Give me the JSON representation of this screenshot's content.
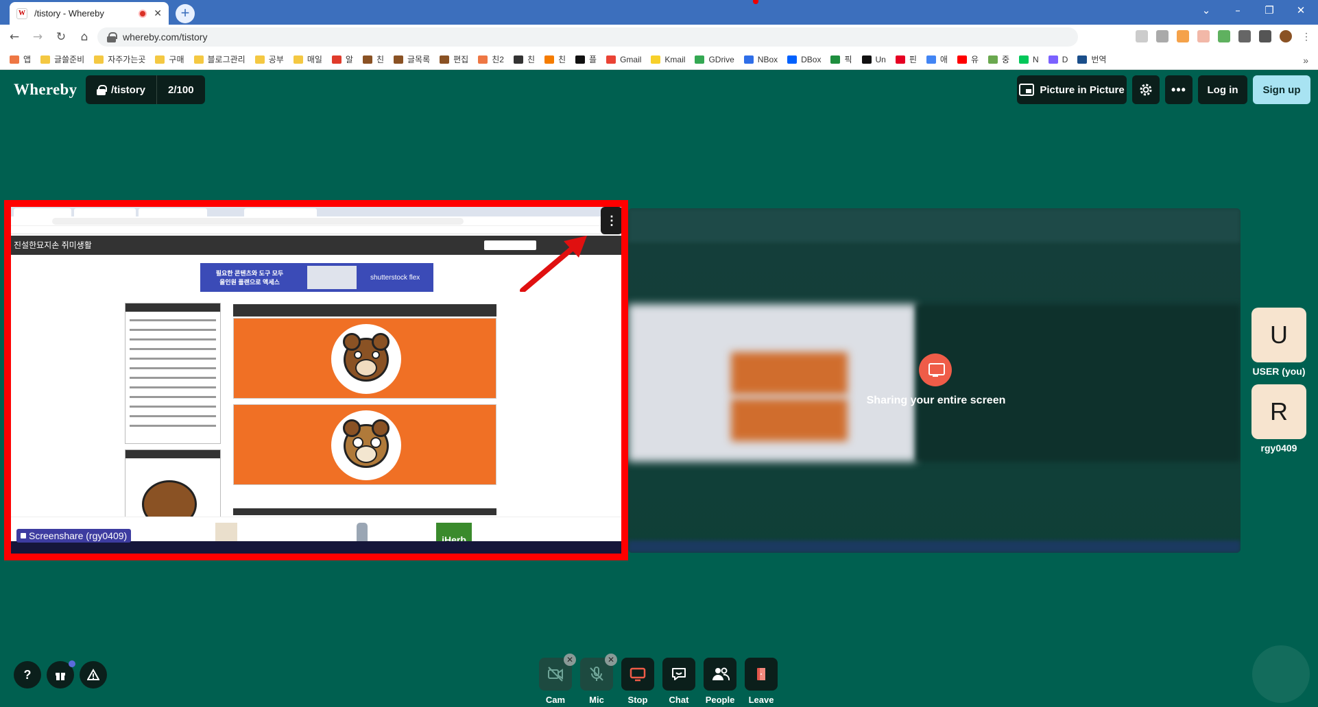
{
  "browser": {
    "tab_title": "/tistory - Whereby",
    "tab_favicon_letter": "W",
    "url": "whereby.com/tistory",
    "bookmarks": [
      "앱",
      "글쓸준비",
      "자주가는곳",
      "구매",
      "블로그관리",
      "공부",
      "매일",
      "알",
      "친",
      "글목록",
      "편집",
      "친2",
      "친",
      "친",
      "플",
      "Gmail",
      "Kmail",
      "GDrive",
      "NBox",
      "DBox",
      "픽",
      "Un",
      "핀",
      "애",
      "유",
      "중",
      "N",
      "D",
      "번역"
    ]
  },
  "header": {
    "logo": "Whereby",
    "room_name": "/tistory",
    "participant_count": "2/100",
    "pip_label": "Picture in Picture",
    "login_label": "Log in",
    "signup_label": "Sign up"
  },
  "screenshare": {
    "label": "Screenshare (rgy0409)",
    "blog_title": "진설한묘지손 쥐미생활",
    "ad_text": "필요한 콘텐츠와 도구 모두 올인원 플랜으로 액세스",
    "ad_brand": "shutterstock flex",
    "iherb": "iHerb",
    "sharing_text": "Sharing your entire screen"
  },
  "participants": [
    {
      "initial": "U",
      "name": "USER (you)"
    },
    {
      "initial": "R",
      "name": "rgy0409"
    }
  ],
  "controls": {
    "cam": "Cam",
    "mic": "Mic",
    "stop": "Stop",
    "chat": "Chat",
    "people": "People",
    "leave": "Leave"
  },
  "colors": {
    "background": "#006050",
    "highlight_border": "#ff0000",
    "arrow": "#e01010",
    "signup": "#a8e3f2",
    "leave": "#e2564b"
  }
}
